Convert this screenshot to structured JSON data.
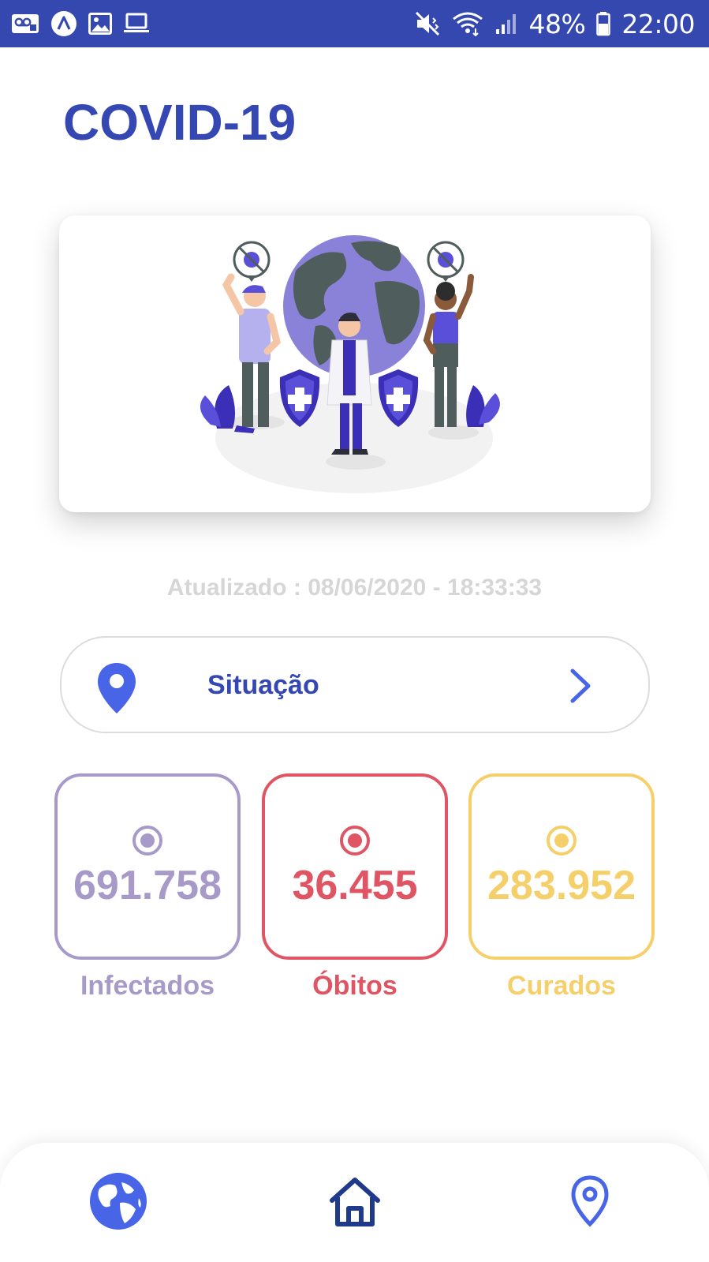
{
  "status_bar": {
    "battery": "48%",
    "time": "22:00",
    "left_icons": [
      "voicemail-icon",
      "app-icon",
      "image-icon",
      "laptop-icon"
    ],
    "right_icons": [
      "mute-icon",
      "wifi-icon",
      "signal-icon",
      "battery-icon"
    ]
  },
  "header": {
    "title": "COVID-19"
  },
  "hero": {
    "illustration": "people-with-globe-illustration"
  },
  "updated_text": "Atualizado : 08/06/2020 - 18:33:33",
  "situation": {
    "label": "Situação",
    "icon": "location-pin-icon",
    "chevron": "chevron-right-icon"
  },
  "stats": [
    {
      "key": "infected",
      "value": "691.758",
      "label": "Infectados",
      "color": "#a79ac9"
    },
    {
      "key": "deaths",
      "value": "36.455",
      "label": "Óbitos",
      "color": "#e05564"
    },
    {
      "key": "recovered",
      "value": "283.952",
      "label": "Curados",
      "color": "#f5cf6a"
    }
  ],
  "bottom_nav": {
    "items": [
      "globe-icon",
      "home-icon",
      "location-pin-icon"
    ],
    "accent": "#4765e6",
    "home_color": "#1f3a8a"
  },
  "colors": {
    "primary": "#3447b3",
    "status_bar": "#3548b0",
    "muted": "#d6d6d6"
  }
}
